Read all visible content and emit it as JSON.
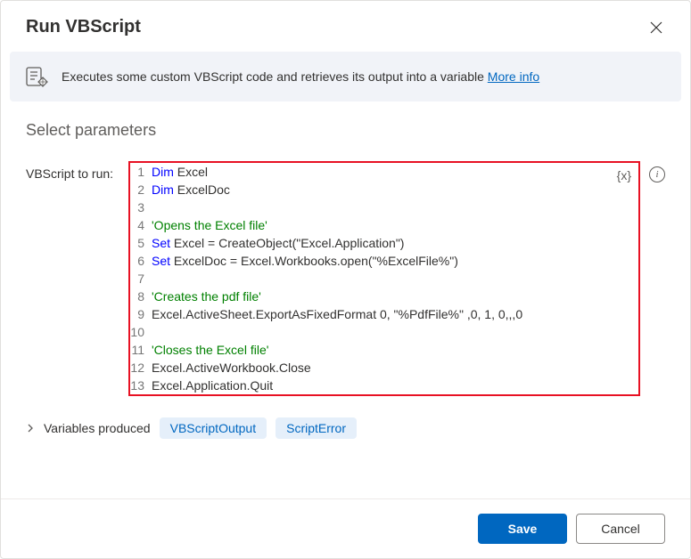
{
  "dialog": {
    "title": "Run VBScript",
    "infoText": "Executes some custom VBScript code and retrieves its output into a variable ",
    "moreInfo": "More info"
  },
  "section": {
    "title": "Select parameters",
    "paramLabel": "VBScript to run:",
    "varToken": "{x}"
  },
  "code": {
    "lines": [
      {
        "n": 1,
        "segs": [
          {
            "t": "Dim",
            "c": "kw"
          },
          {
            "t": " Excel"
          }
        ]
      },
      {
        "n": 2,
        "segs": [
          {
            "t": "Dim",
            "c": "kw"
          },
          {
            "t": " ExcelDoc"
          }
        ]
      },
      {
        "n": 3,
        "segs": []
      },
      {
        "n": 4,
        "segs": [
          {
            "t": "'Opens the Excel file'",
            "c": "cm"
          }
        ]
      },
      {
        "n": 5,
        "segs": [
          {
            "t": "Set",
            "c": "kw"
          },
          {
            "t": " Excel = CreateObject(\"Excel.Application\")"
          }
        ]
      },
      {
        "n": 6,
        "segs": [
          {
            "t": "Set",
            "c": "kw"
          },
          {
            "t": " ExcelDoc = Excel.Workbooks.open(\"%ExcelFile%\")"
          }
        ]
      },
      {
        "n": 7,
        "segs": []
      },
      {
        "n": 8,
        "segs": [
          {
            "t": "'Creates the pdf file'",
            "c": "cm"
          }
        ]
      },
      {
        "n": 9,
        "segs": [
          {
            "t": "Excel.ActiveSheet.ExportAsFixedFormat 0, \"%PdfFile%\" ,0, 1, 0,,,0"
          }
        ]
      },
      {
        "n": 10,
        "segs": []
      },
      {
        "n": 11,
        "segs": [
          {
            "t": "'Closes the Excel file'",
            "c": "cm"
          }
        ]
      },
      {
        "n": 12,
        "segs": [
          {
            "t": "Excel.ActiveWorkbook.Close"
          }
        ]
      },
      {
        "n": 13,
        "segs": [
          {
            "t": "Excel.Application.Quit"
          }
        ]
      }
    ]
  },
  "varsProduced": {
    "label": "Variables produced",
    "items": [
      "VBScriptOutput",
      "ScriptError"
    ]
  },
  "footer": {
    "save": "Save",
    "cancel": "Cancel"
  }
}
